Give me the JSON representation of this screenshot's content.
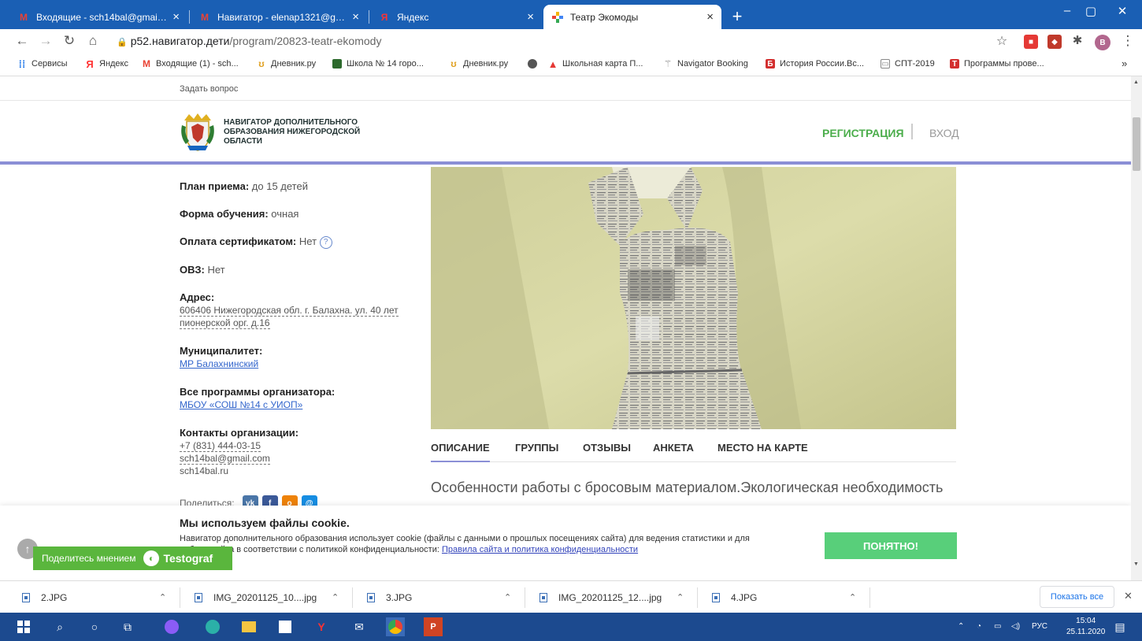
{
  "browser": {
    "tabs": [
      {
        "title": "Входящие - sch14bal@gmail.com",
        "icon": "gmail-icon"
      },
      {
        "title": "Навигатор - elenap1321@gmail.",
        "icon": "gmail-icon"
      },
      {
        "title": "Яндекс",
        "icon": "yandex-icon"
      },
      {
        "title": "Театр Экомоды",
        "icon": "site-icon"
      }
    ],
    "url_host": "p52.навигатор.дети",
    "url_path": "/program/20823-teatr-ekomody",
    "profile_initial": "В",
    "bookmarks": [
      {
        "label": "Сервисы",
        "icon": "apps-icon"
      },
      {
        "label": "Яндекс",
        "icon": "yandex-icon"
      },
      {
        "label": "Входящие (1) - sch...",
        "icon": "gmail-icon"
      },
      {
        "label": "Дневник.ру",
        "icon": "dnevnik-icon"
      },
      {
        "label": "Школа № 14 горо...",
        "icon": "school-icon"
      },
      {
        "label": "Дневник.ру",
        "icon": "dnevnik-icon"
      },
      {
        "label": "",
        "icon": "globe-icon"
      },
      {
        "label": "Школьная карта П...",
        "icon": "map-icon"
      },
      {
        "label": "Navigator Booking",
        "icon": "navigator-icon"
      },
      {
        "label": "История России.Вс...",
        "icon": "history-icon"
      },
      {
        "label": "СПТ-2019",
        "icon": "spt-icon"
      },
      {
        "label": "Программы прове...",
        "icon": "programs-icon"
      }
    ],
    "bookmarks_more": "»"
  },
  "site": {
    "ask_link": "Задать вопрос",
    "brand": "НАВИГАТОР ДОПОЛНИТЕЛЬНОГО ОБРАЗОВАНИЯ НИЖЕГОРОДСКОЙ ОБЛАСТИ",
    "register": "РЕГИСТРАЦИЯ",
    "login": "ВХОД"
  },
  "program": {
    "plan_label": "План приема:",
    "plan_value": "до 15 детей",
    "form_label": "Форма обучения:",
    "form_value": "очная",
    "cert_label": "Оплата сертификатом:",
    "cert_value": "Нет",
    "ovz_label": "ОВЗ:",
    "ovz_value": "Нет",
    "address_label": "Адрес:",
    "address_value": "606406 Нижегородская обл. г. Балахна. ул. 40 лет пионерской орг. д.16",
    "municipality_label": "Муниципалитет:",
    "municipality_value": "МР Балахнинский",
    "organizer_label": "Все программы организатора:",
    "organizer_value": "МБОУ «СОШ №14 с УИОП»",
    "contacts_label": "Контакты организации:",
    "phone": "+7 (831) 444-03-15",
    "email": "sch14bal@gmail.com",
    "website": "sch14bal.ru",
    "share_label": "Поделиться:",
    "tabs": [
      "ОПИСАНИЕ",
      "ГРУППЫ",
      "ОТЗЫВЫ",
      "АНКЕТА",
      "МЕСТО НА КАРТЕ"
    ],
    "description": "Особенности работы с бросовым материалом.Экологическая необходимость"
  },
  "cookie": {
    "title": "Мы используем файлы cookie.",
    "text": "Навигатор дополнительного образования использует cookie (файлы с данными о прошлых посещениях сайта) для ведения статистики и для",
    "text2": "работы сайта в соответствии с политикой конфиденциальности:",
    "link": "Правила сайта и политика конфиденциальности",
    "button": "ПОНЯТНО!"
  },
  "feedback": {
    "label": "Поделитесь мнением",
    "brand": "Testograf"
  },
  "downloads": {
    "items": [
      "2.JPG",
      "IMG_20201125_10....jpg",
      "3.JPG",
      "IMG_20201125_12....jpg",
      "4.JPG"
    ],
    "show_all": "Показать все"
  },
  "taskbar": {
    "lang": "РУС",
    "time": "15:04",
    "date": "25.11.2020"
  }
}
